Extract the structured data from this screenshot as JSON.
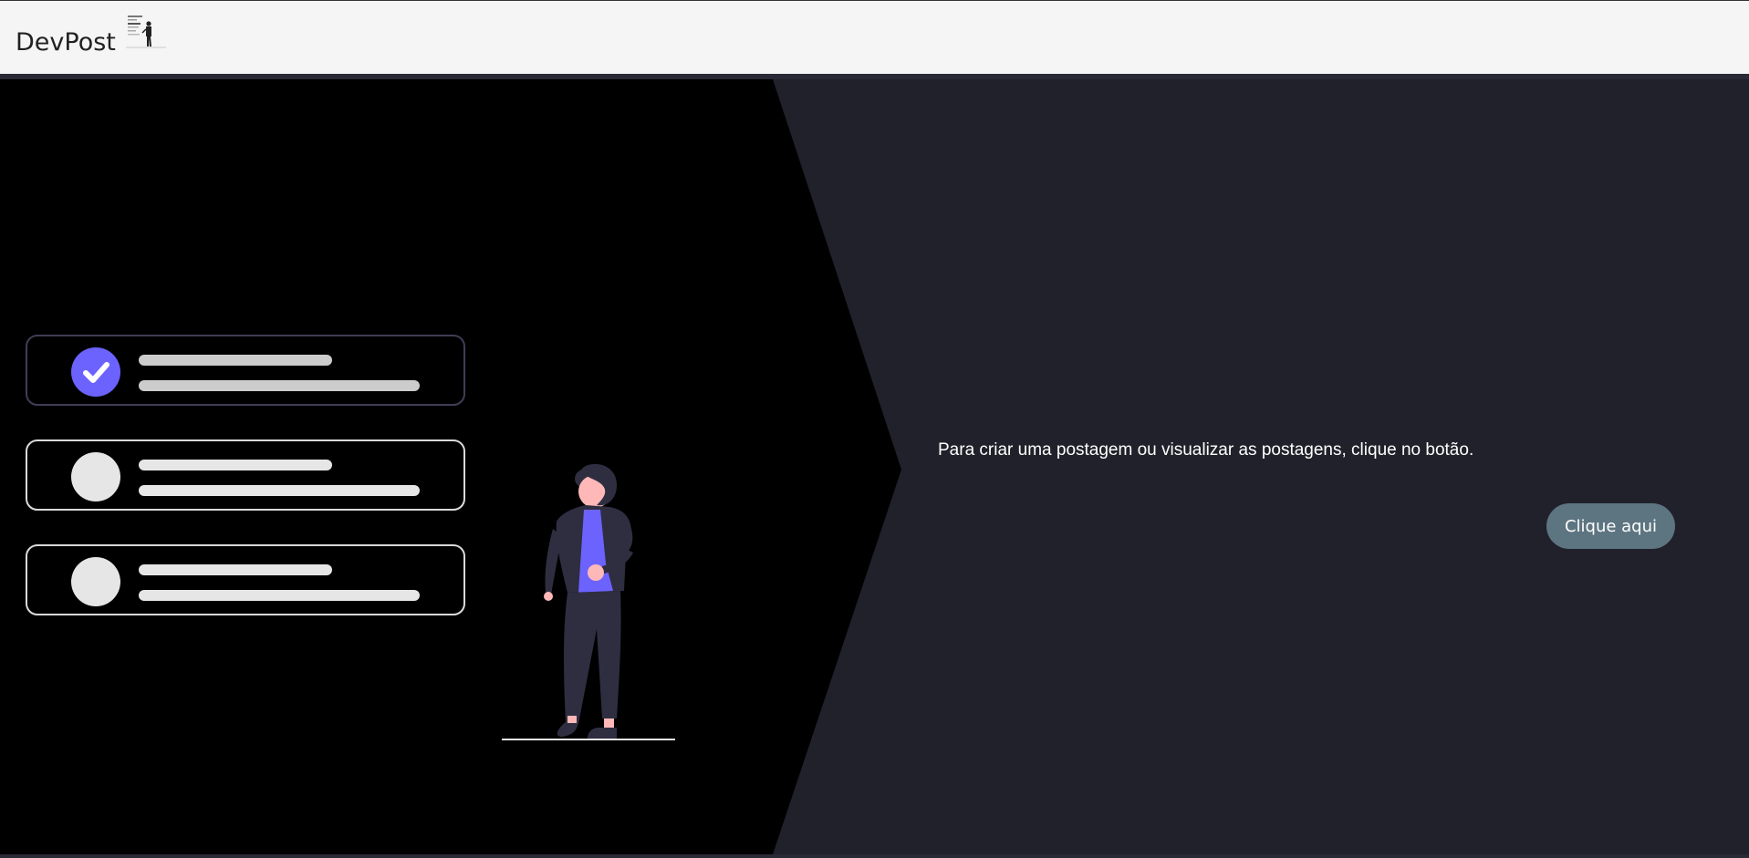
{
  "navbar": {
    "brand": "DevPost",
    "logo_icon": "person-at-board-logo"
  },
  "hero": {
    "illustration": "checklist-person-illustration",
    "checklist_items": [
      {
        "state": "checked"
      },
      {
        "state": "unchecked"
      },
      {
        "state": "unchecked"
      }
    ],
    "message": "Para criar uma postagem ou visualizar as postagens, clique no botão.",
    "button_label": "Clique aqui"
  },
  "colors": {
    "navbar_bg": "#f5f5f5",
    "hero_dark": "#000000",
    "hero_panel": "#21212b",
    "accent": "#6c63ff",
    "button_bg": "#5d7580"
  }
}
